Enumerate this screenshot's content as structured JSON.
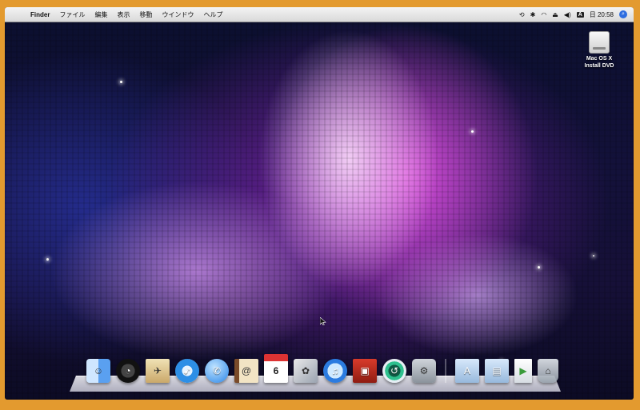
{
  "menubar": {
    "apple": "",
    "items": [
      "Finder",
      "ファイル",
      "編集",
      "表示",
      "移動",
      "ウインドウ",
      "ヘルプ"
    ],
    "status": {
      "ime": "A",
      "clock": "日 20:58"
    }
  },
  "desktop": {
    "drive_label": "Mac OS X\nInstall DVD",
    "drive_label_lines": [
      "Mac OS X",
      "Install DVD"
    ]
  },
  "dock": {
    "apps": [
      "finder-icon",
      "dashboard-icon",
      "mail-icon",
      "safari-icon",
      "ichat-icon",
      "address-book-icon",
      "ical-icon",
      "preview-icon",
      "itunes-icon",
      "photo-booth-icon",
      "time-machine-icon",
      "system-preferences-icon"
    ],
    "ical_date": "6",
    "stacks": [
      "applications-folder-icon",
      "documents-folder-icon",
      "document-icon",
      "trash-icon"
    ]
  }
}
